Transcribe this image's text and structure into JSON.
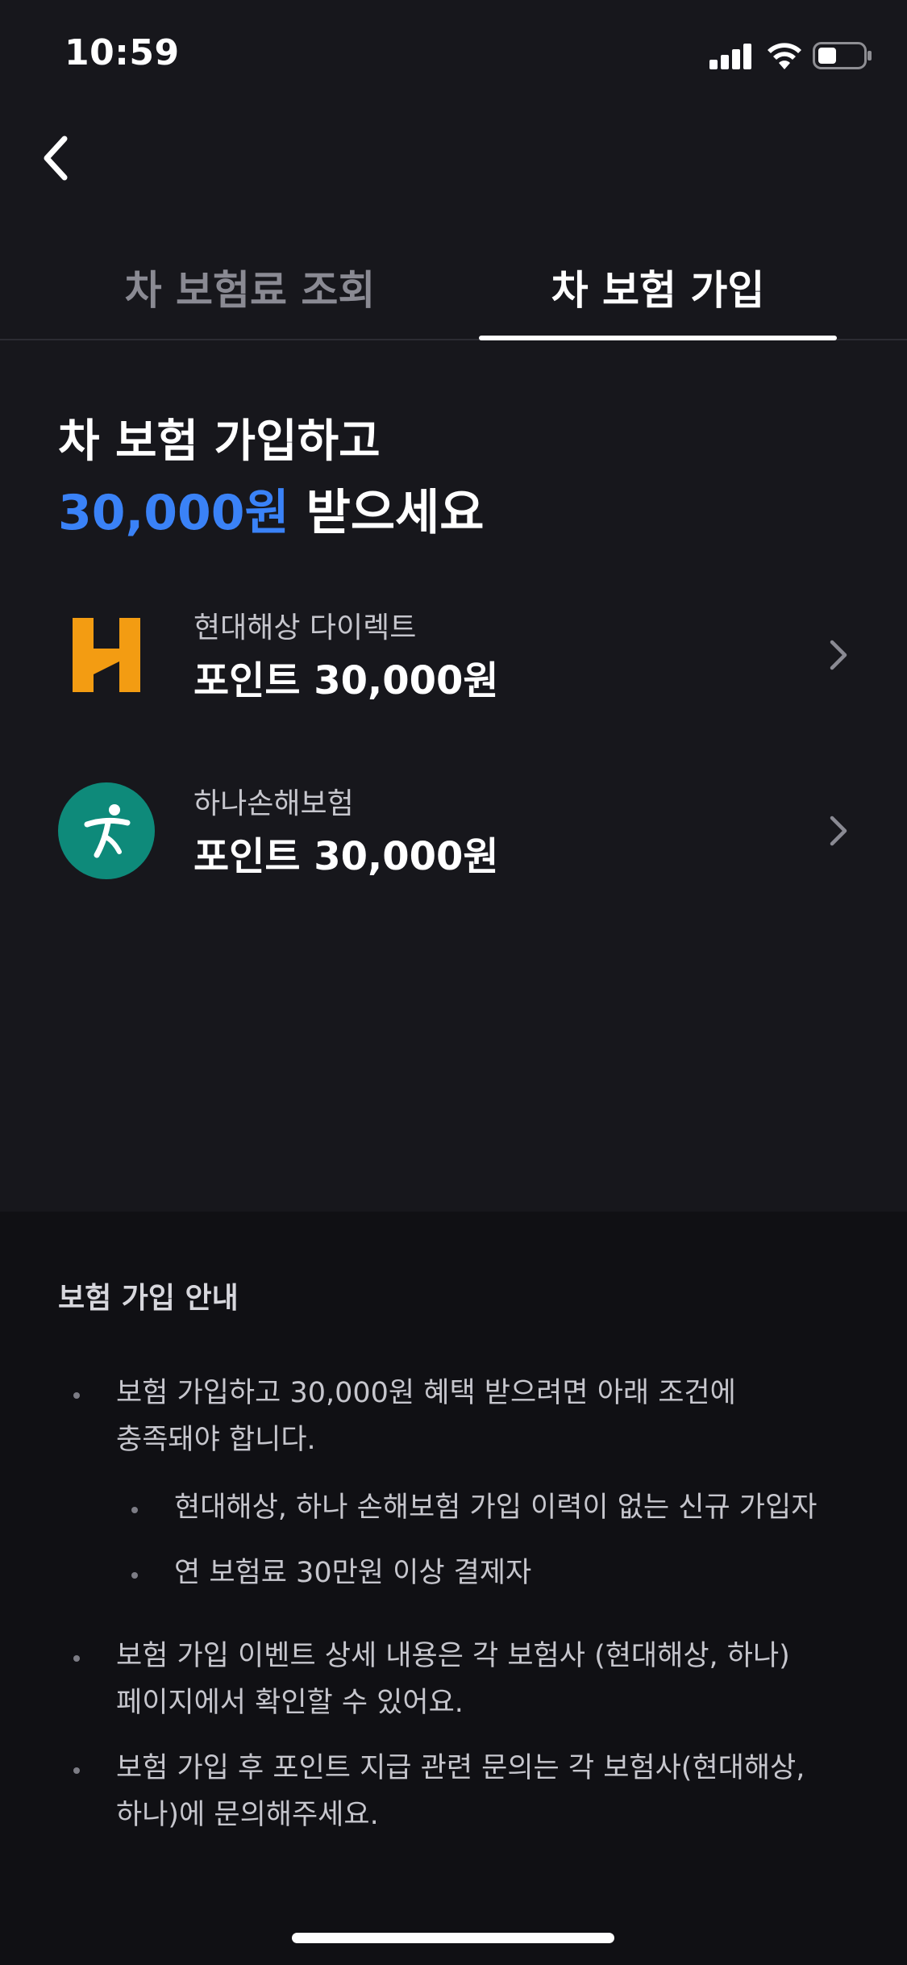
{
  "status_bar": {
    "time": "10:59"
  },
  "tabs": [
    {
      "label": "차 보험료 조회",
      "active": false
    },
    {
      "label": "차 보험 가입",
      "active": true
    }
  ],
  "hero": {
    "line1": "차 보험 가입하고",
    "amount": "30,000원",
    "suffix": " 받으세요",
    "accent_color": "#3a82f7"
  },
  "insurers": [
    {
      "name": "현대해상 다이렉트",
      "point": "포인트 30,000원",
      "logo_icon": "hyundai-marine-logo-icon",
      "logo_color": "#f39c12"
    },
    {
      "name": "하나손해보험",
      "point": "포인트 30,000원",
      "logo_icon": "hana-insurance-logo-icon",
      "logo_color": "#0e8a7a"
    }
  ],
  "info": {
    "title": "보험 가입 안내",
    "bullets": [
      {
        "line1": "보험 가입하고 30,000원 혜택 받으려면 아래 조건에",
        "line2": "충족돼야 합니다."
      },
      {
        "sub1": "현대해상, 하나 손해보험 가입 이력이 없는 신규 가입자",
        "sub2": "연 보험료 30만원 이상 결제자"
      },
      {
        "line1": "보험 가입 이벤트 상세 내용은 각 보험사 (현대해상, 하나)",
        "line2": "페이지에서 확인할 수 있어요."
      },
      {
        "line1": "보험 가입 후 포인트 지급 관련 문의는 각 보험사(현대해상,",
        "line2": "하나)에 문의해주세요."
      }
    ]
  }
}
